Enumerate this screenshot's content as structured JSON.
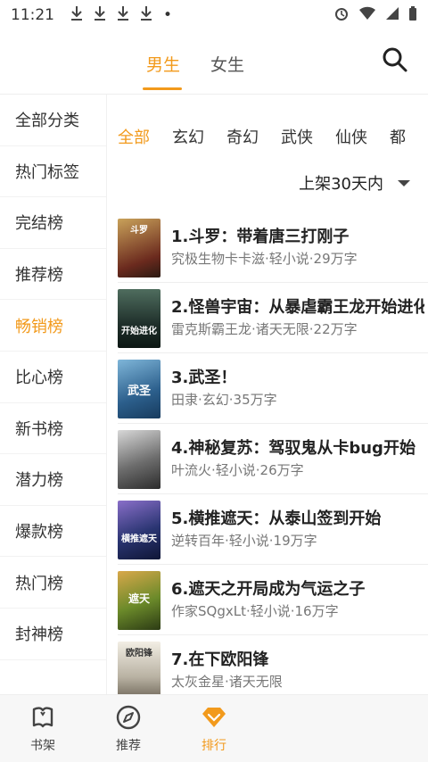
{
  "status_bar": {
    "time": "11:21",
    "download_icons": [
      "download-icon",
      "download-icon",
      "download-icon",
      "download-icon"
    ],
    "dot": "•",
    "right_icons": [
      "alarm-icon",
      "wifi-icon",
      "signal-icon",
      "battery-icon"
    ]
  },
  "header": {
    "tabs": [
      "男生",
      "女生"
    ],
    "active_tab": "男生"
  },
  "sidebar": {
    "items": [
      "全部分类",
      "热门标签",
      "完结榜",
      "推荐榜",
      "畅销榜",
      "比心榜",
      "新书榜",
      "潜力榜",
      "爆款榜",
      "热门榜",
      "封神榜"
    ],
    "active": "畅销榜"
  },
  "categories": {
    "items": [
      "全部",
      "玄幻",
      "奇幻",
      "武侠",
      "仙侠",
      "都"
    ],
    "active": "全部"
  },
  "filter": {
    "label": "上架30天内"
  },
  "books": [
    {
      "title": "1.斗罗：带着唐三打刚子",
      "meta": "究极生物卡卡滋·轻小说·29万字",
      "cover_text": "斗罗"
    },
    {
      "title": "2.怪兽宇宙：从暴虐霸王龙开始进化",
      "meta": "雷克斯霸王龙·诸天无限·22万字",
      "cover_text": "开始进化"
    },
    {
      "title": "3.武圣！",
      "meta": "田隶·玄幻·35万字",
      "cover_text": "武圣"
    },
    {
      "title": "4.神秘复苏：驾驭鬼从卡bug开始",
      "meta": "叶流火·轻小说·26万字",
      "cover_text": ""
    },
    {
      "title": "5.横推遮天：从泰山签到开始",
      "meta": "逆转百年·轻小说·19万字",
      "cover_text": "横推遮天"
    },
    {
      "title": "6.遮天之开局成为气运之子",
      "meta": "作家SQgxLt·轻小说·16万字",
      "cover_text": "遮天"
    },
    {
      "title": "7.在下欧阳锋",
      "meta": "太灰金星·诸天无限",
      "cover_text": "欧阳锋"
    }
  ],
  "bottom_nav": {
    "items": [
      "书架",
      "推荐",
      "排行"
    ],
    "active": "排行"
  },
  "colors": {
    "accent": "#f29a1c",
    "text": "#222222",
    "muted": "#777777"
  }
}
